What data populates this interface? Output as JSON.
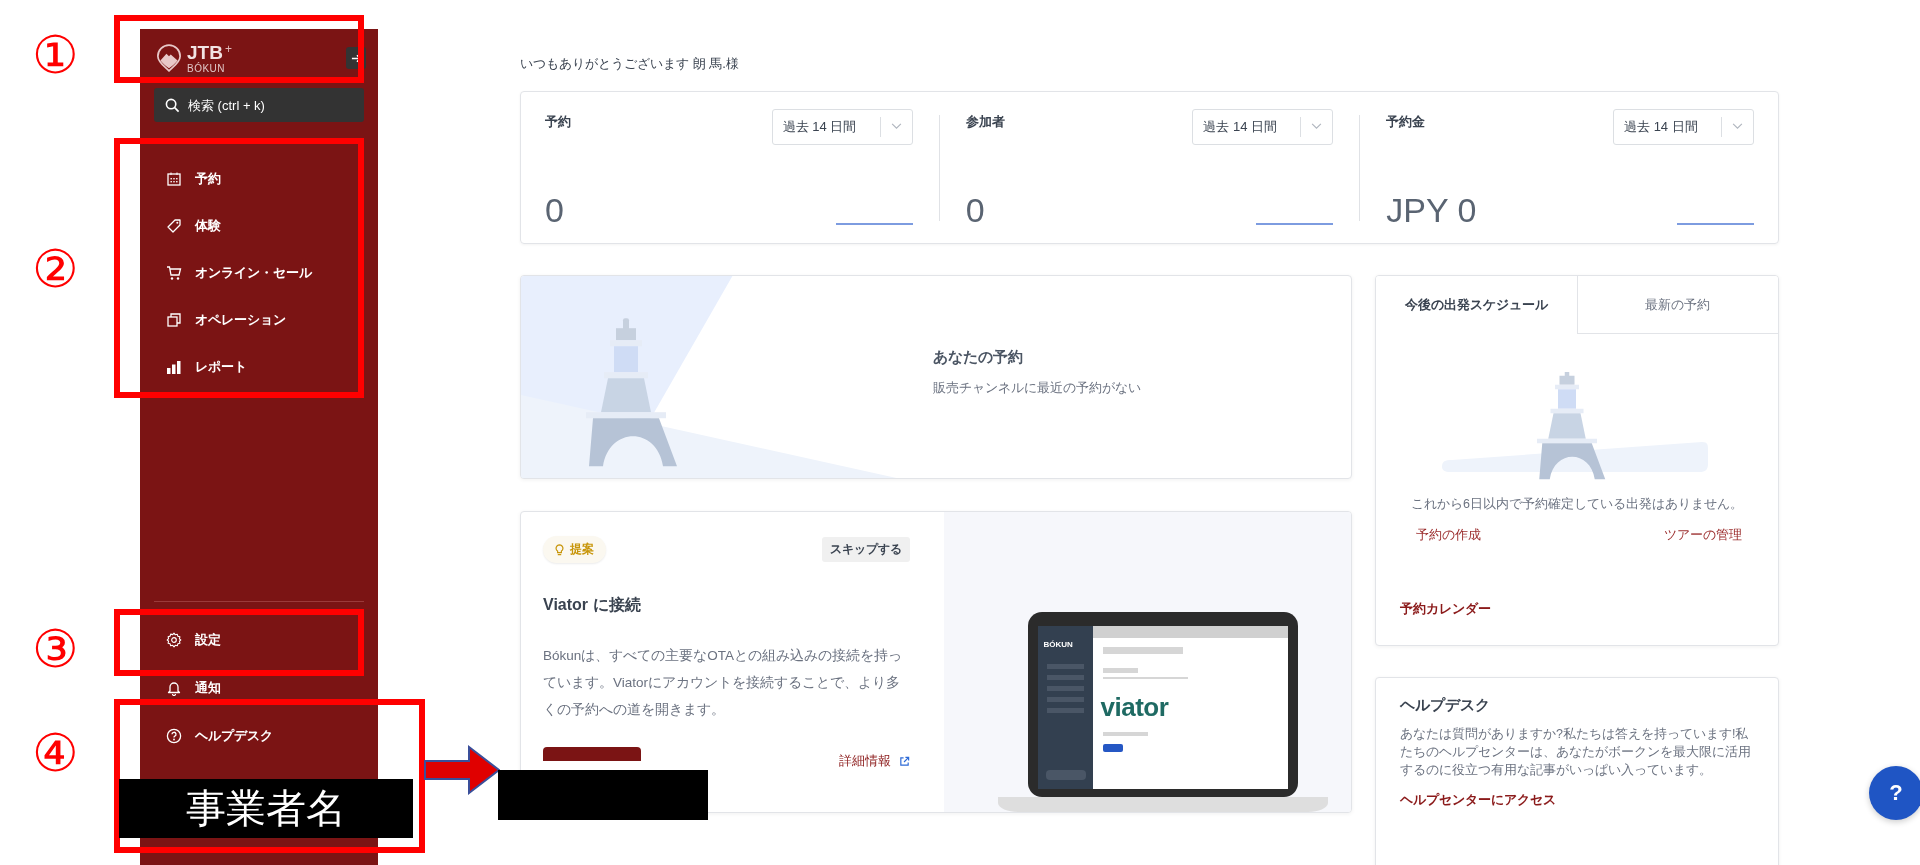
{
  "sidebar": {
    "logo": {
      "title": "JTB",
      "plus": "+",
      "subtitle": "BÓKUN"
    },
    "search": {
      "placeholder": "検索 (ctrl + k)"
    },
    "nav_items": [
      {
        "label": "予約",
        "kind": "calendar"
      },
      {
        "label": "体験",
        "kind": "tag"
      },
      {
        "label": "オンライン・セール",
        "kind": "cart"
      },
      {
        "label": "オペレーション",
        "kind": "copy"
      },
      {
        "label": "レポート",
        "kind": "chart"
      }
    ],
    "bottom_items": [
      {
        "label": "設定",
        "kind": "gear"
      },
      {
        "label": "通知",
        "kind": "bell"
      },
      {
        "label": "ヘルプデスク",
        "kind": "help"
      }
    ]
  },
  "greeting": "いつもありがとうございます 朗 馬.様",
  "stats": [
    {
      "title": "予約",
      "period": "過去 14 日間",
      "value": "0"
    },
    {
      "title": "参加者",
      "period": "過去 14 日間",
      "value": "0"
    },
    {
      "title": "予約金",
      "period": "過去 14 日間",
      "value": "JPY 0"
    }
  ],
  "empty_bookings": {
    "title": "あなたの予約",
    "message": "販売チャンネルに最近の予約がない"
  },
  "suggestion": {
    "badge": "提案",
    "skip": "スキップする",
    "title": "Viator に接続",
    "body": "Bókunは、すべての主要なOTAとの組み込みの接続を持っています。Viatorにアカウントを接続することで、より多くの予約への道を開きます。",
    "more_link": "詳細情報",
    "mockup": {
      "brand": "BÓKUN",
      "partner": "viator"
    }
  },
  "schedule": {
    "tabs": [
      {
        "label": "今後の出発スケジュール",
        "selected": true
      },
      {
        "label": "最新の予約",
        "selected": false
      }
    ],
    "message": "これから6日以内で予約確定している出発はありません。",
    "links": [
      "予約の作成",
      "ツアーの管理"
    ],
    "calendar_link": "予約カレンダー"
  },
  "helpdesk": {
    "title": "ヘルプデスク",
    "body": "あなたは質問がありますか?私たちは答えを持っています!私たちのヘルプセンターは、あなたがボークンを最大限に活用するのに役立つ有用な記事がいっぱい入っています。",
    "link": "ヘルプセンターにアクセス"
  },
  "help_button": "?",
  "annotations": {
    "markers": [
      "①",
      "②",
      "③",
      "④"
    ],
    "redacted_label": "事業者名"
  }
}
